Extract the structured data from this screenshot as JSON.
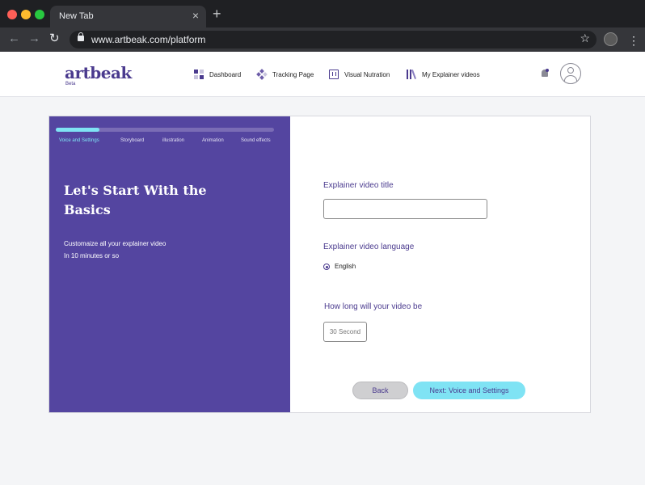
{
  "browser": {
    "tab_title": "New Tab",
    "tab_close": "×",
    "new_tab": "+",
    "url": "www.artbeak.com/platform",
    "back": "←",
    "forward": "→",
    "reload": "↻",
    "star": "☆",
    "menu": "⋮"
  },
  "app": {
    "logo": "artbeak",
    "beta": "Beta",
    "nav": [
      {
        "label": "Dashboard",
        "icon": "dashboard-icon"
      },
      {
        "label": "Tracking Page",
        "icon": "tracking-icon"
      },
      {
        "label": "Visual Nutration",
        "icon": "visual-icon"
      },
      {
        "label": "My Explainer videos",
        "icon": "explainer-icon"
      }
    ],
    "colors": {
      "brand": "#4a3a8e",
      "panel": "#5445a0",
      "accent": "#7fe3f4"
    }
  },
  "wizard": {
    "progress": 0.2,
    "steps": [
      "Voice and Settings",
      "Storyboard",
      "illustration",
      "Animation",
      "Sound effects"
    ],
    "active_step": 0,
    "heading": "Let's Start With the Basics",
    "subtext_line1": "Customaize all your explainer video",
    "subtext_line2": "In 10 minutes or so",
    "title_label": "Explainer video title",
    "title_value": "",
    "language_label": "Explainer video language",
    "language_option": "English",
    "length_label": "How long will your video be",
    "length_value": "30 Second",
    "back_label": "Back",
    "next_label": "Next: Voice and Settings"
  }
}
